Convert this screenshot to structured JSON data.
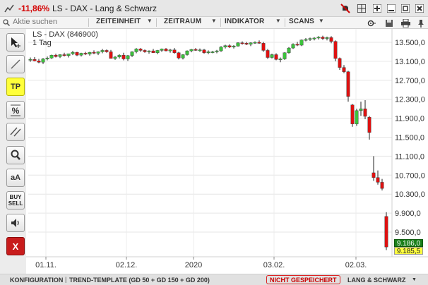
{
  "window": {
    "change_pct": "-11,86%",
    "title": "LS - DAX - Lang & Schwarz"
  },
  "toolbar": {
    "search_placeholder": "Aktie suchen",
    "menus": [
      "ZEITEINHEIT",
      "ZEITRAUM",
      "INDIKATOR",
      "SCANS"
    ]
  },
  "tools": {
    "tp_label": "TP",
    "aa_label": "aA",
    "buy_label": "BUY",
    "sell_label": "SELL",
    "close_label": "X"
  },
  "chart_header": {
    "instrument": "LS - DAX (846900)",
    "interval": "1 Tag"
  },
  "last_price": {
    "upper": "9.186,0",
    "lower": "9.185,5",
    "upper_color": "#1a7f1a",
    "lower_color": "#ffff40"
  },
  "statusbar": {
    "config": "KONFIGURATION",
    "template": "TREND-TEMPLATE (GD 50 + GD 150 + GD 200)",
    "not_saved": "NICHT GESPEICHERT",
    "source": "LANG & SCHWARZ"
  },
  "colors": {
    "up": "#3cc23c",
    "down": "#dd1111"
  },
  "chart_data": {
    "type": "candlestick",
    "xticks": [
      "01.11.",
      "02.12.",
      "2020",
      "03.02.",
      "02.03."
    ],
    "yticks": [
      "13.500,0",
      "13.100,0",
      "12.700,0",
      "12.300,0",
      "11.900,0",
      "11.500,0",
      "11.100,0",
      "10.700,0",
      "10.300,0",
      "9.900,0",
      "9.500,0"
    ],
    "ylim": [
      9100,
      13750
    ],
    "grid": true,
    "candles": [
      [
        13130,
        13180,
        13090,
        13140
      ],
      [
        13140,
        13190,
        13100,
        13110
      ],
      [
        13110,
        13150,
        13060,
        13080
      ],
      [
        13080,
        13170,
        13040,
        13150
      ],
      [
        13150,
        13200,
        13120,
        13170
      ],
      [
        13170,
        13240,
        13150,
        13230
      ],
      [
        13230,
        13260,
        13180,
        13200
      ],
      [
        13200,
        13250,
        13170,
        13240
      ],
      [
        13240,
        13280,
        13200,
        13220
      ],
      [
        13220,
        13260,
        13180,
        13260
      ],
      [
        13260,
        13320,
        13230,
        13290
      ],
      [
        13290,
        13300,
        13210,
        13230
      ],
      [
        13230,
        13280,
        13200,
        13270
      ],
      [
        13270,
        13300,
        13230,
        13250
      ],
      [
        13250,
        13300,
        13220,
        13290
      ],
      [
        13290,
        13330,
        13250,
        13270
      ],
      [
        13270,
        13310,
        13230,
        13300
      ],
      [
        13300,
        13360,
        13270,
        13330
      ],
      [
        13330,
        13350,
        13280,
        13300
      ],
      [
        13300,
        13340,
        13200,
        13160
      ],
      [
        13160,
        13210,
        13130,
        13190
      ],
      [
        13190,
        13250,
        13160,
        13230
      ],
      [
        13230,
        13280,
        13120,
        13150
      ],
      [
        13150,
        13230,
        13110,
        13220
      ],
      [
        13220,
        13310,
        13190,
        13300
      ],
      [
        13300,
        13380,
        13270,
        13360
      ],
      [
        13360,
        13380,
        13300,
        13330
      ],
      [
        13330,
        13350,
        13280,
        13300
      ],
      [
        13300,
        13330,
        13260,
        13320
      ],
      [
        13320,
        13360,
        13280,
        13280
      ],
      [
        13280,
        13340,
        13250,
        13330
      ],
      [
        13330,
        13370,
        13300,
        13360
      ],
      [
        13360,
        13380,
        13310,
        13320
      ],
      [
        13320,
        13360,
        13280,
        13340
      ],
      [
        13340,
        13380,
        13260,
        13280
      ],
      [
        13280,
        13300,
        13140,
        13170
      ],
      [
        13170,
        13250,
        13140,
        13240
      ],
      [
        13240,
        13330,
        13220,
        13320
      ],
      [
        13320,
        13360,
        13290,
        13350
      ],
      [
        13350,
        13380,
        13320,
        13330
      ],
      [
        13330,
        13370,
        13300,
        13340
      ],
      [
        13340,
        13360,
        13260,
        13280
      ],
      [
        13280,
        13330,
        13250,
        13300
      ],
      [
        13300,
        13320,
        13270,
        13300
      ],
      [
        13300,
        13340,
        13270,
        13320
      ],
      [
        13320,
        13420,
        13300,
        13400
      ],
      [
        13400,
        13450,
        13370,
        13430
      ],
      [
        13430,
        13460,
        13380,
        13400
      ],
      [
        13400,
        13440,
        13370,
        13420
      ],
      [
        13420,
        13500,
        13410,
        13490
      ],
      [
        13490,
        13520,
        13450,
        13480
      ],
      [
        13480,
        13510,
        13440,
        13460
      ],
      [
        13460,
        13500,
        13420,
        13490
      ],
      [
        13490,
        13520,
        13470,
        13500
      ],
      [
        13500,
        13540,
        13470,
        13480
      ],
      [
        13480,
        13510,
        13300,
        13330
      ],
      [
        13330,
        13360,
        13150,
        13180
      ],
      [
        13180,
        13260,
        13160,
        13240
      ],
      [
        13240,
        13270,
        13120,
        13140
      ],
      [
        13140,
        13180,
        13080,
        13150
      ],
      [
        13150,
        13290,
        13130,
        13280
      ],
      [
        13280,
        13400,
        13260,
        13380
      ],
      [
        13380,
        13480,
        13360,
        13460
      ],
      [
        13460,
        13510,
        13420,
        13440
      ],
      [
        13440,
        13560,
        13420,
        13550
      ],
      [
        13550,
        13590,
        13520,
        13560
      ],
      [
        13560,
        13600,
        13530,
        13580
      ],
      [
        13580,
        13610,
        13540,
        13590
      ],
      [
        13590,
        13630,
        13560,
        13610
      ],
      [
        13610,
        13640,
        13550,
        13580
      ],
      [
        13580,
        13620,
        13540,
        13600
      ],
      [
        13600,
        13630,
        13480,
        13520
      ],
      [
        13520,
        13540,
        13100,
        13160
      ],
      [
        13160,
        13180,
        12920,
        12970
      ],
      [
        12970,
        13020,
        12850,
        12880
      ],
      [
        12880,
        12900,
        12250,
        12360
      ],
      [
        12180,
        12200,
        11720,
        11780
      ],
      [
        11780,
        12100,
        11740,
        12060
      ],
      [
        12060,
        12250,
        11950,
        12100
      ],
      [
        12100,
        12280,
        11880,
        11940
      ],
      [
        11920,
        11950,
        11450,
        11600
      ],
      [
        10750,
        11100,
        10580,
        10650
      ],
      [
        10650,
        10800,
        10500,
        10550
      ],
      [
        10550,
        10620,
        10380,
        10420
      ],
      [
        9830,
        9920,
        9120,
        9186
      ]
    ]
  }
}
